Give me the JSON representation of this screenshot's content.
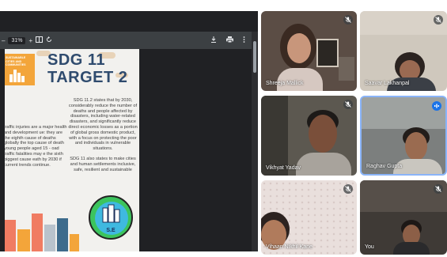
{
  "pdf_toolbar": {
    "minus": "–",
    "zoom": "31%",
    "plus": "+",
    "icons": [
      "fit-page-icon",
      "rotate-icon",
      "download-icon",
      "print-icon",
      "more-icon"
    ]
  },
  "slide": {
    "title_line1": "SDG 11",
    "title_line2": "TARGET 2",
    "badge_text": "SUSTAINABLE CITIES AND COMMUNITIES",
    "paragraph1": "SDG 11.2 states that by 2030, considerably reduce the number of deaths and people affected by disasters, including water-related disasters, and significantly reduce direct economic losses as a portion of global gross domestic product, with a focus on protecting the poor and individuals in vulnerable situations.",
    "paragraph2": "SDG 11 also states to make cities and human settlements inclusive, safe, resilient and sustainable",
    "left_text": "traffic injuries are a major health and development ue: they are the eighth cause of deaths globally the top cause of death young people aged 15 - oad traffic fatalities may e the sixth biggest cause eath by 2030 if current trends continue.",
    "logo_text": "S.E"
  },
  "participants": [
    {
      "name": "Shreeja Mallick",
      "muted": true
    },
    {
      "name": "Saavar Lakhanpal",
      "muted": true
    },
    {
      "name": "Vikhyat Yadav",
      "muted": true
    },
    {
      "name": "Raghav Gupta",
      "muted": false,
      "speaking": true
    },
    {
      "name": "Vihaan Nikhil Kane",
      "muted": true
    },
    {
      "name": "You",
      "muted": true
    }
  ],
  "colors": {
    "accent_speaking": "#8ab4f8",
    "badge": "#f3a53a",
    "title": "#2f4b6e"
  }
}
